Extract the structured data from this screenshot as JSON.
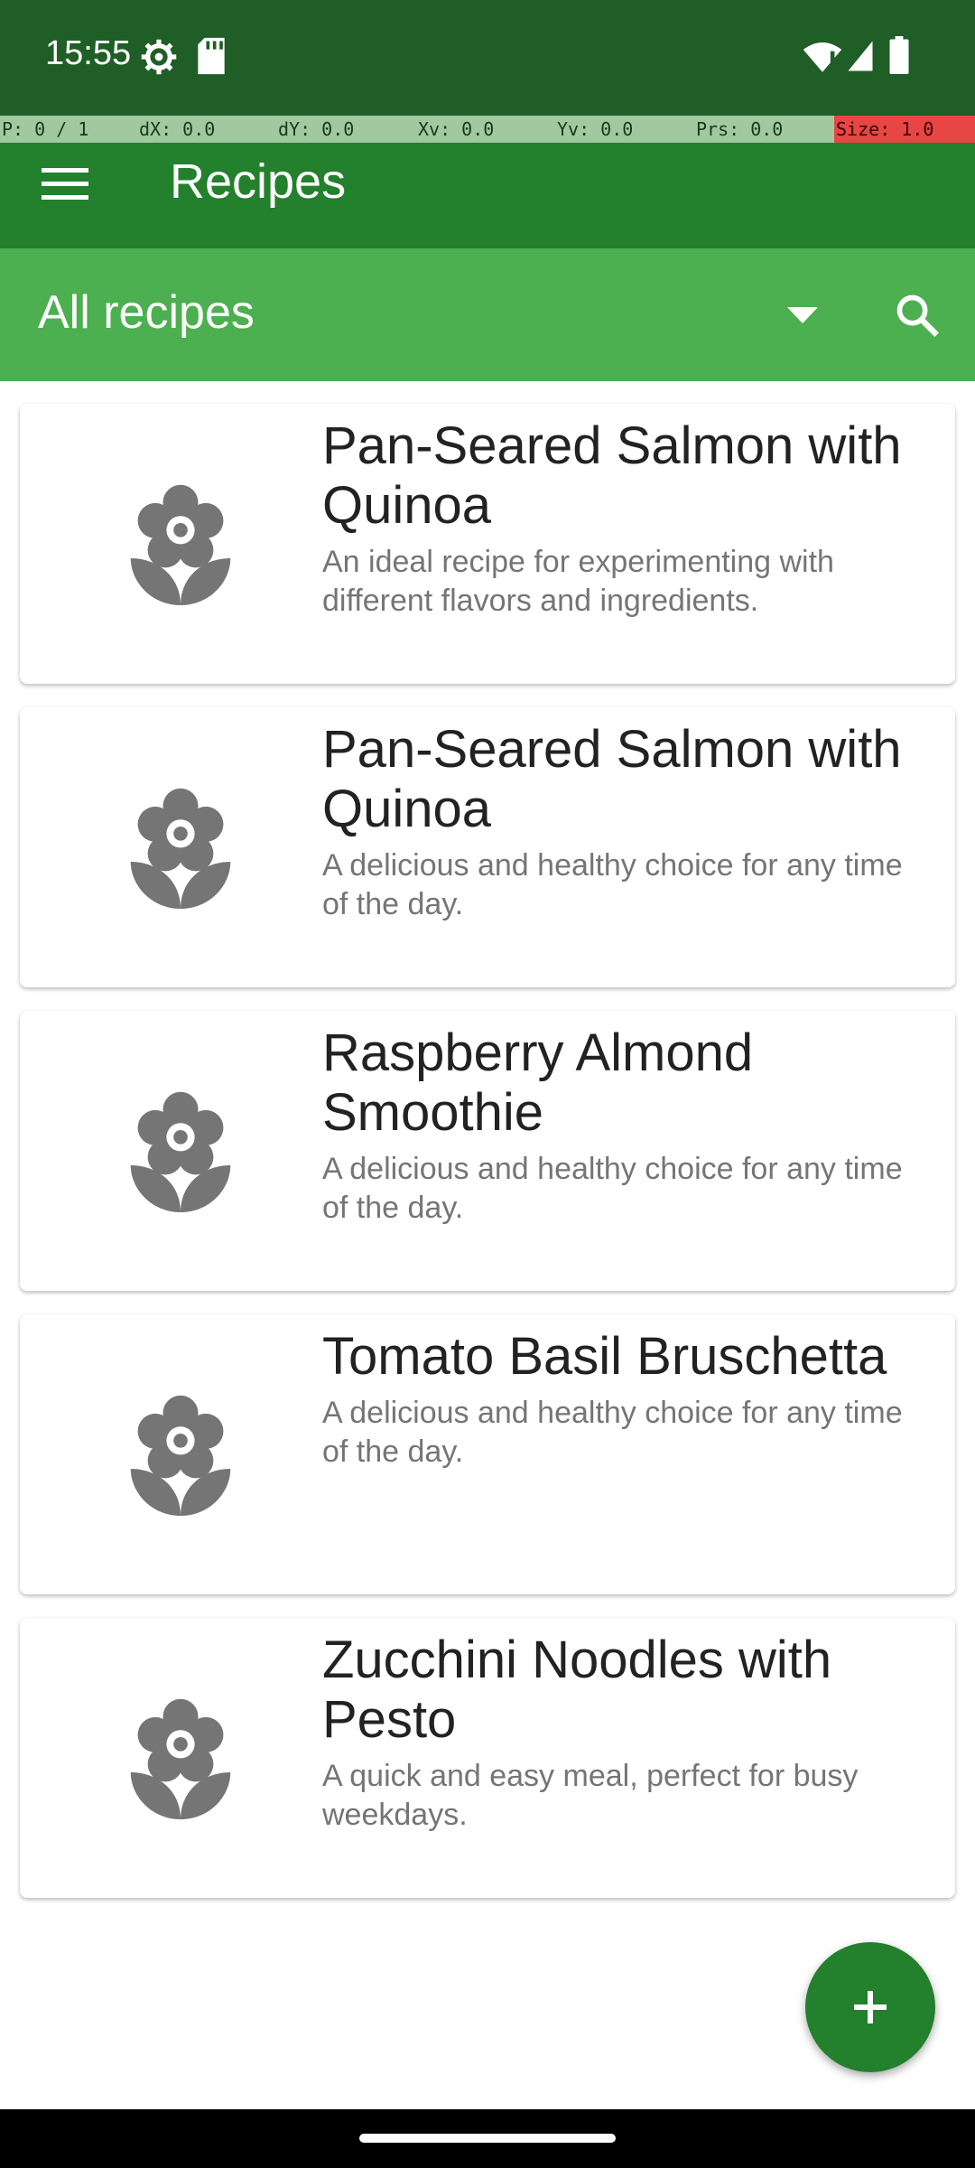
{
  "status_bar": {
    "time": "15:55",
    "icons": [
      "gear-icon",
      "sd-card-icon",
      "wifi-icon",
      "signal-icon",
      "battery-icon"
    ]
  },
  "debug_bar": {
    "pointer": "P: 0 / 1",
    "dx": "dX: 0.0",
    "dy": "dY: 0.0",
    "xv": "Xv: 0.0",
    "yv": "Yv: 0.0",
    "prs": "Prs: 0.0",
    "size": "Size: 1.0"
  },
  "app_bar": {
    "title": "Recipes",
    "menu_icon": "hamburger-menu-icon"
  },
  "filter_bar": {
    "selected": "All recipes",
    "dropdown_icon": "dropdown-arrow-icon",
    "search_icon": "search-icon"
  },
  "recipes": [
    {
      "title": "Pan-Seared Salmon with Quinoa",
      "description": "An ideal recipe for experimenting with different flavors and ingredients.",
      "icon": "flower-icon"
    },
    {
      "title": "Pan-Seared Salmon with Quinoa",
      "description": "A delicious and healthy choice for any time of the day.",
      "icon": "flower-icon"
    },
    {
      "title": "Raspberry Almond Smoothie",
      "description": "A delicious and healthy choice for any time of the day.",
      "icon": "flower-icon"
    },
    {
      "title": "Tomato Basil Bruschetta",
      "description": "A delicious and healthy choice for any time of the day.",
      "icon": "flower-icon"
    },
    {
      "title": "Zucchini Noodles with Pesto",
      "description": "A quick and easy meal, perfect for busy weekdays.",
      "icon": "flower-icon"
    }
  ],
  "fab": {
    "icon": "plus-icon"
  },
  "colors": {
    "status_bar": "#1f5e26",
    "app_bar": "#23802d",
    "filter_bar": "#4caf50",
    "fab": "#23802d",
    "recipe_icon": "#757575"
  }
}
